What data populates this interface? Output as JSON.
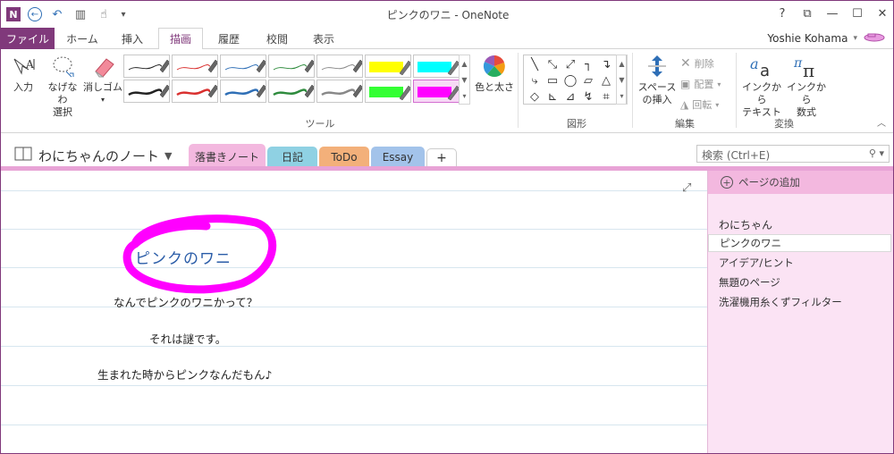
{
  "window": {
    "title": "ピンクのワニ - OneNote",
    "user": "Yoshie Kohama",
    "controls": [
      "?",
      "⧉",
      "—",
      "☐",
      "✕"
    ]
  },
  "qat": {
    "app_icon": "N",
    "back": "←",
    "undo": "↶",
    "dock": "▥",
    "touch": "☝",
    "more": "▾"
  },
  "tabs": {
    "file": "ファイル",
    "items": [
      "ホーム",
      "挿入",
      "描画",
      "履歴",
      "校閲",
      "表示"
    ],
    "active": "描画"
  },
  "ribbon": {
    "type_label": "入力",
    "lasso_label": "なげなわ\n選択",
    "lasso_line1": "なげなわ",
    "lasso_line2": "選択",
    "eraser_label": "消しゴム",
    "color_label": "色と太さ",
    "tools_group": "ツール",
    "shapes_group": "図形",
    "space_line1": "スペース",
    "space_line2": "の挿入",
    "delete_label": "削除",
    "arrange_label": "配置",
    "rotate_label": "回転",
    "edit_group": "編集",
    "ink2text_line1": "インクから",
    "ink2text_line2": "テキスト",
    "ink2math_line1": "インクから",
    "ink2math_line2": "数式",
    "convert_group": "変換",
    "pens": [
      {
        "color": "#222222",
        "width": 1
      },
      {
        "color": "#d9302f",
        "width": 1
      },
      {
        "color": "#2f6fb6",
        "width": 1
      },
      {
        "color": "#2e8b3d",
        "width": 1
      },
      {
        "color": "#888888",
        "width": 1
      },
      {
        "color": "#ffff00",
        "width": 12
      },
      {
        "color": "#00ffff",
        "width": 12
      },
      {
        "color": "#222222",
        "width": 2.5
      },
      {
        "color": "#d9302f",
        "width": 2.5
      },
      {
        "color": "#2f6fb6",
        "width": 2.5
      },
      {
        "color": "#2e8b3d",
        "width": 2.5
      },
      {
        "color": "#888888",
        "width": 2.5
      },
      {
        "color": "#33ff33",
        "width": 12
      },
      {
        "color": "#ff00ff",
        "width": 12
      }
    ],
    "shapes": [
      "╲",
      "⤡",
      "⤢",
      "┐",
      "↴",
      "⤷",
      "▭",
      "◯",
      "▱",
      "△",
      "◇",
      "⊾",
      "⊿",
      "↯",
      "⌗"
    ]
  },
  "notebook": {
    "name": "わにちゃんのノート",
    "sections": [
      {
        "label": "落書きノート",
        "color": "#f3b8df"
      },
      {
        "label": "日記",
        "color": "#8fd1e3"
      },
      {
        "label": "ToDo",
        "color": "#f3b07a"
      },
      {
        "label": "Essay",
        "color": "#a3c3ea"
      },
      {
        "label": "+",
        "color": "#ffffff"
      }
    ],
    "search_placeholder": "検索 (Ctrl+E)"
  },
  "page": {
    "title": "ピンクのワニ",
    "lines": [
      "なんでピンクのワニかって？",
      "それは謎です。",
      "生まれた時からピンクなんだもん♪"
    ],
    "expand_icon": "⤢"
  },
  "pages_pane": {
    "add_label": "ページの追加",
    "items": [
      "わにちゃん",
      "ピンクのワニ",
      "アイデア/ヒント",
      "無題のページ",
      "洗濯機用糸くずフィルター"
    ]
  },
  "colors": {
    "accent": "#80397b",
    "highlight": "#ff00ff",
    "pane": "#fbe3f4"
  }
}
